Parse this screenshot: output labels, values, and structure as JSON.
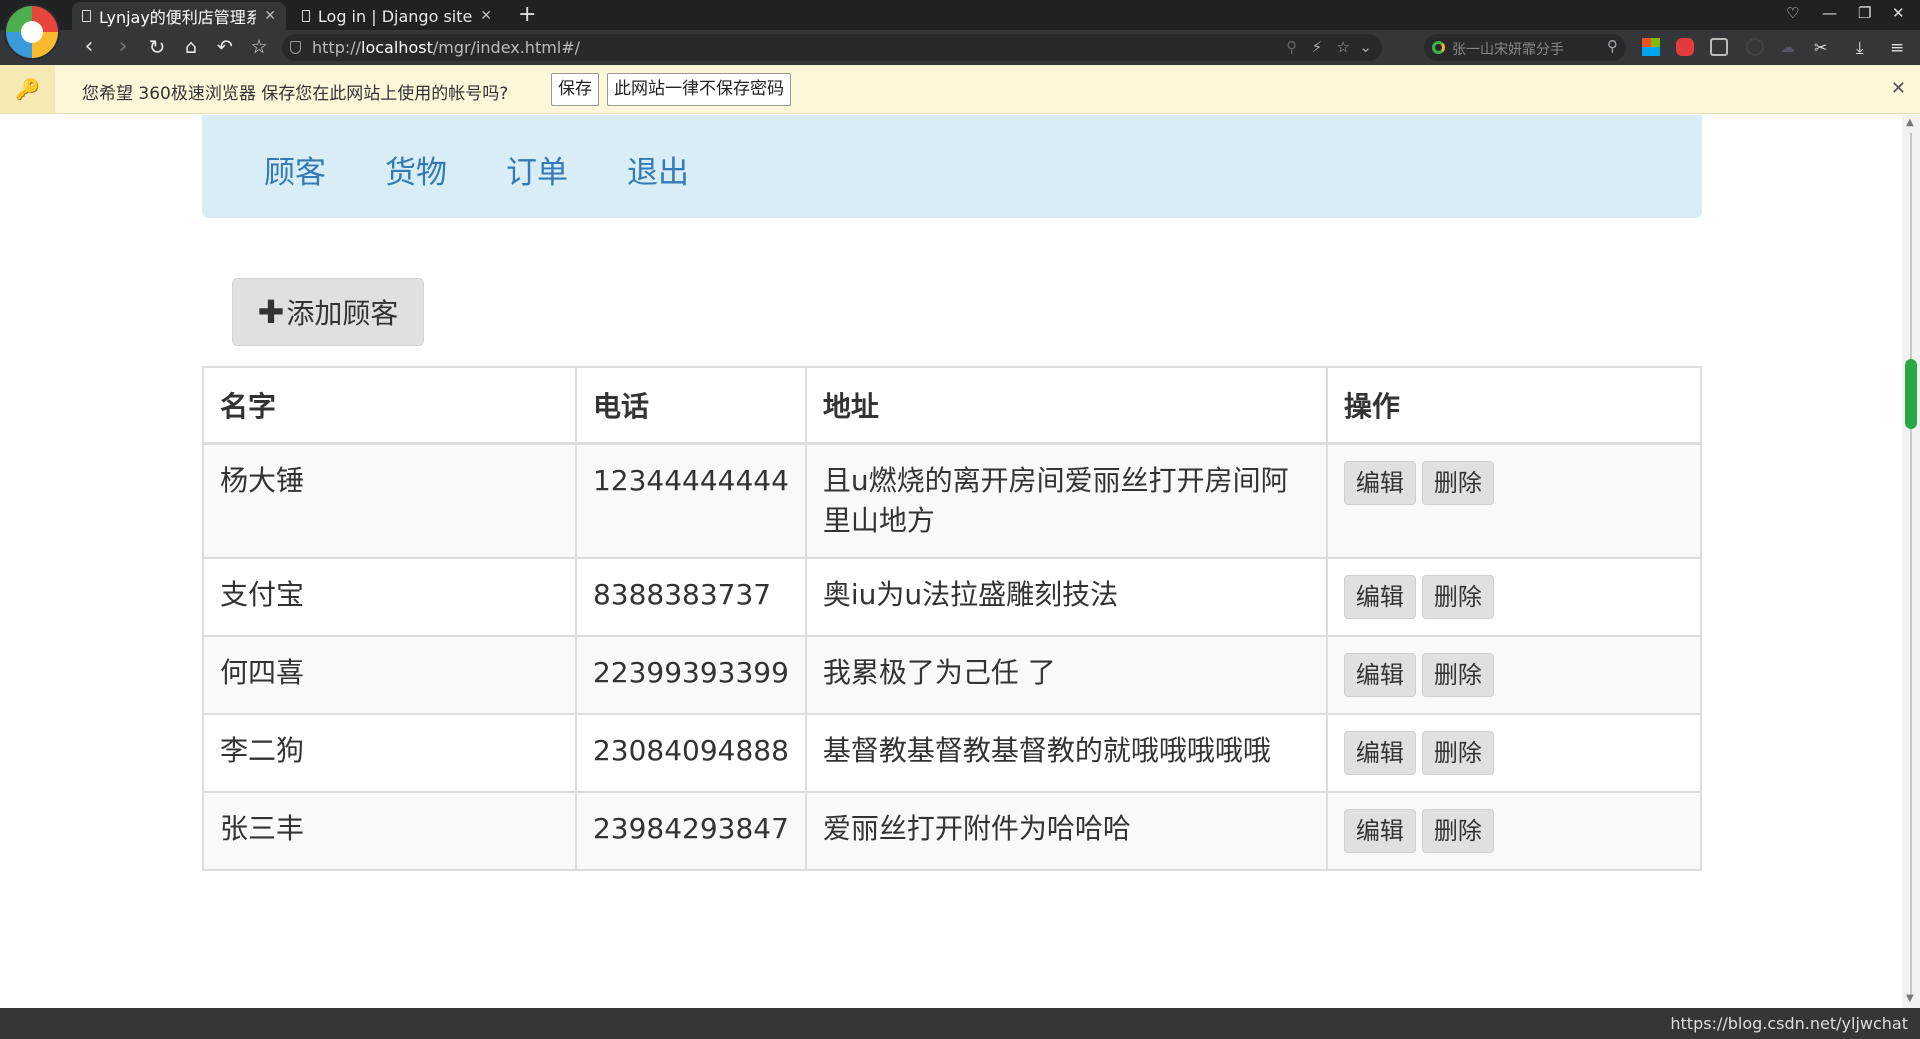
{
  "browser": {
    "tabs": [
      {
        "title": "Lynjay的便利店管理系统",
        "active": true
      },
      {
        "title": "Log in | Django site admin",
        "active": false
      }
    ],
    "url_prefix": "http://",
    "url_host": "localhost",
    "url_path": "/mgr/index.html#/",
    "search_placeholder": "张一山宋妍霏分手",
    "status_text": "https://blog.csdn.net/yljwchat"
  },
  "password_bar": {
    "message": "您希望 360极速浏览器 保存您在此网站上使用的帐号吗?",
    "save_label": "保存",
    "never_label": "此网站一律不保存密码"
  },
  "nav": {
    "items": [
      "顾客",
      "货物",
      "订单",
      "退出"
    ]
  },
  "add_button_label": "添加顾客",
  "table": {
    "headers": [
      "名字",
      "电话",
      "地址",
      "操作"
    ],
    "edit_label": "编辑",
    "delete_label": "删除",
    "rows": [
      {
        "name": "杨大锤",
        "phone": "12344444444",
        "address": "且u燃烧的离开房间爱丽丝打开房间阿里山地方"
      },
      {
        "name": "支付宝",
        "phone": "8388383737",
        "address": "奥iu为u法拉盛雕刻技法"
      },
      {
        "name": "何四喜",
        "phone": "22399393399",
        "address": "我累极了为己任 了"
      },
      {
        "name": "李二狗",
        "phone": "23084094888",
        "address": "基督教基督教基督教的就哦哦哦哦哦"
      },
      {
        "name": "张三丰",
        "phone": "23984293847",
        "address": "爱丽丝打开附件为哈哈哈"
      }
    ]
  },
  "colors": {
    "navbar_bg": "#d9edf7",
    "link": "#337ab7",
    "scroll_thumb": "#2aa844"
  }
}
